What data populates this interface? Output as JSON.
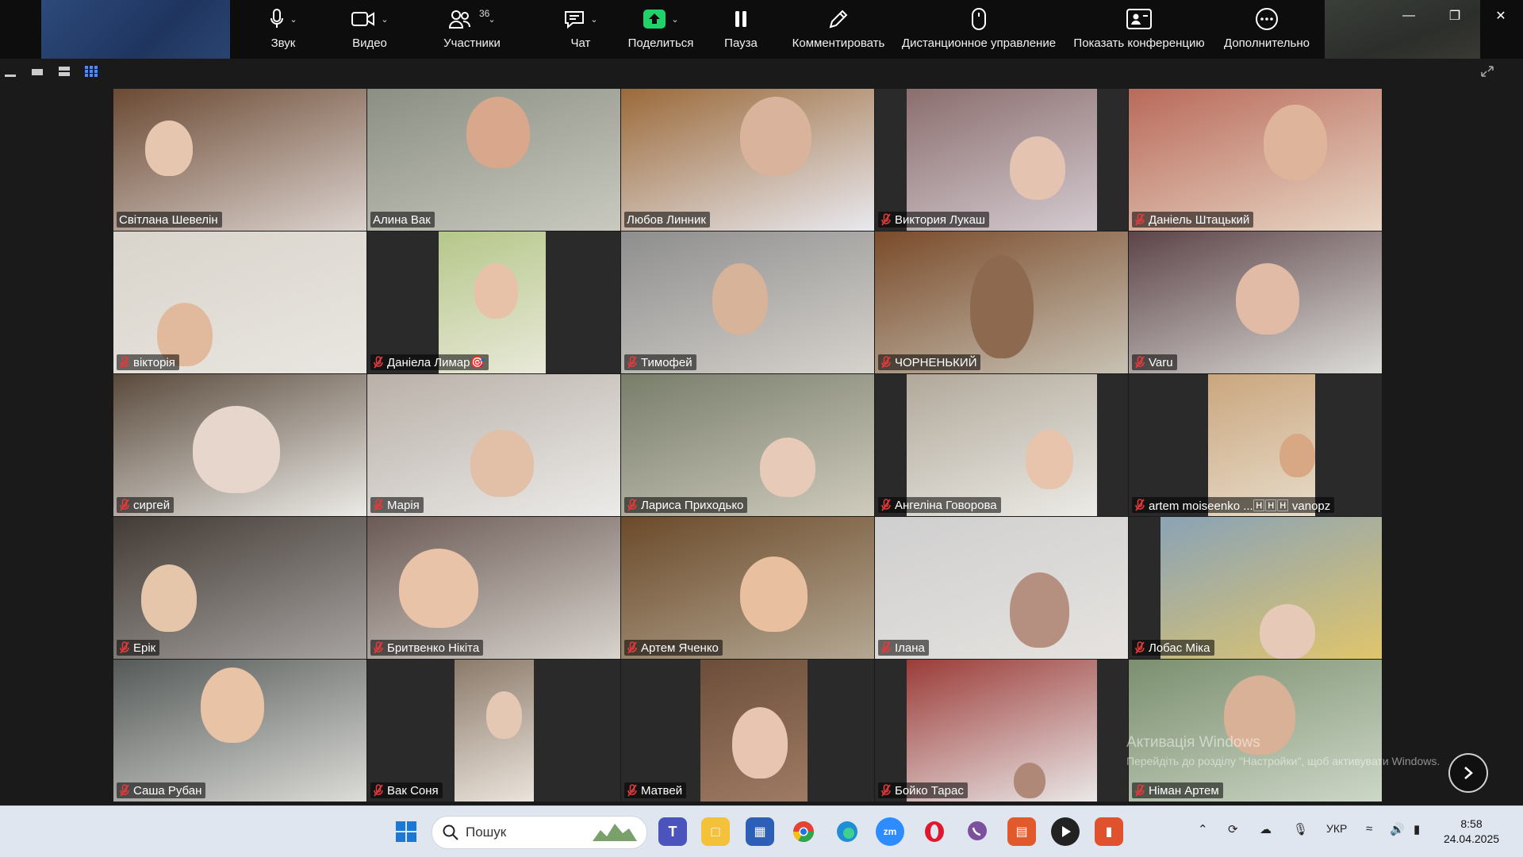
{
  "toolbar": {
    "participant_count": "36",
    "buttons": [
      {
        "label": "Звук",
        "icon": "microphone-icon"
      },
      {
        "label": "Видео",
        "icon": "video-camera-icon"
      },
      {
        "label": "Участники",
        "icon": "participants-icon"
      },
      {
        "label": "Чат",
        "icon": "chat-icon"
      },
      {
        "label": "Поделиться",
        "icon": "share-screen-icon"
      },
      {
        "label": "Пауза",
        "icon": "pause-icon"
      },
      {
        "label": "Комментировать",
        "icon": "annotate-pen-icon"
      },
      {
        "label": "Дистанционное управление",
        "icon": "remote-control-mouse-icon"
      },
      {
        "label": "Показать конференцию",
        "icon": "show-meeting-icon"
      },
      {
        "label": "Дополнительно",
        "icon": "more-icon"
      }
    ]
  },
  "colors": {
    "active_speaker": "#1ee3a6",
    "share_green": "#1fd36a",
    "muted_red": "#e23b3b",
    "toolbar_bg": "#0d0d0d"
  },
  "participants": [
    {
      "name": "Світлана Шевелін",
      "muted": false,
      "active": true
    },
    {
      "name": "Алина Вак",
      "muted": false
    },
    {
      "name": "Любов Линник",
      "muted": false
    },
    {
      "name": "Виктория Лукаш",
      "muted": true
    },
    {
      "name": "Даніель Штацький",
      "muted": true
    },
    {
      "name": "вікторія",
      "muted": true
    },
    {
      "name": "Даніела Лимар🎯",
      "muted": true
    },
    {
      "name": "Тимофей",
      "muted": true
    },
    {
      "name": "ЧОРНЕНЬКИЙ",
      "muted": true
    },
    {
      "name": "Varu",
      "muted": true
    },
    {
      "name": "сиргей",
      "muted": true
    },
    {
      "name": "Марія",
      "muted": true
    },
    {
      "name": "Лариса Приходько",
      "muted": true
    },
    {
      "name": "Ангеліна Говорова",
      "muted": true
    },
    {
      "name": "artem moiseenko ...🄷🄷🄷 vanopz",
      "muted": true
    },
    {
      "name": "Ерік",
      "muted": true
    },
    {
      "name": "Бритвенко Нікіта",
      "muted": true
    },
    {
      "name": "Артем Яченко",
      "muted": true
    },
    {
      "name": "Ілана",
      "muted": true
    },
    {
      "name": "Лобас Міка",
      "muted": true
    },
    {
      "name": "Саша Рубан",
      "muted": true
    },
    {
      "name": "Вак Соня",
      "muted": true
    },
    {
      "name": "Матвей",
      "muted": true
    },
    {
      "name": "Бойко Тарас",
      "muted": true
    },
    {
      "name": "Німан Артем",
      "muted": true
    }
  ],
  "watermark": {
    "line1": "Активація Windows",
    "line2": "Перейдіть до розділу \"Настройки\", щоб активувати Windows."
  },
  "taskbar": {
    "search_placeholder": "Пошук",
    "language": "УКР",
    "time": "8:58",
    "date": "24.04.2025"
  }
}
